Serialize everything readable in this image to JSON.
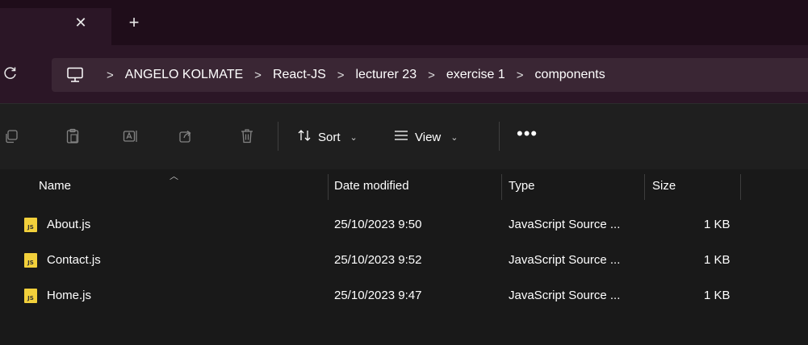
{
  "tabs": {
    "close_glyph": "✕",
    "new_glyph": "+"
  },
  "address": {
    "breadcrumbs": [
      "ANGELO KOLMATE",
      "React-JS",
      "lecturer 23",
      "exercise 1",
      "components"
    ],
    "separator": ">"
  },
  "toolbar": {
    "sort_label": "Sort",
    "view_label": "View",
    "more_label": "•••"
  },
  "columns": {
    "name": "Name",
    "date_modified": "Date modified",
    "type": "Type",
    "size": "Size"
  },
  "files": [
    {
      "name": "About.js",
      "date": "25/10/2023 9:50",
      "type": "JavaScript Source ...",
      "size": "1 KB",
      "icon": "js-file-icon"
    },
    {
      "name": "Contact.js",
      "date": "25/10/2023 9:52",
      "type": "JavaScript Source ...",
      "size": "1 KB",
      "icon": "js-file-icon"
    },
    {
      "name": "Home.js",
      "date": "25/10/2023 9:47",
      "type": "JavaScript Source ...",
      "size": "1 KB",
      "icon": "js-file-icon"
    }
  ],
  "colors": {
    "tab_strip": "#1f0d1a",
    "address_row": "#2b1626",
    "toolbar": "#1f1f1f",
    "list_bg": "#191919",
    "js_icon": "#f2d03b"
  }
}
